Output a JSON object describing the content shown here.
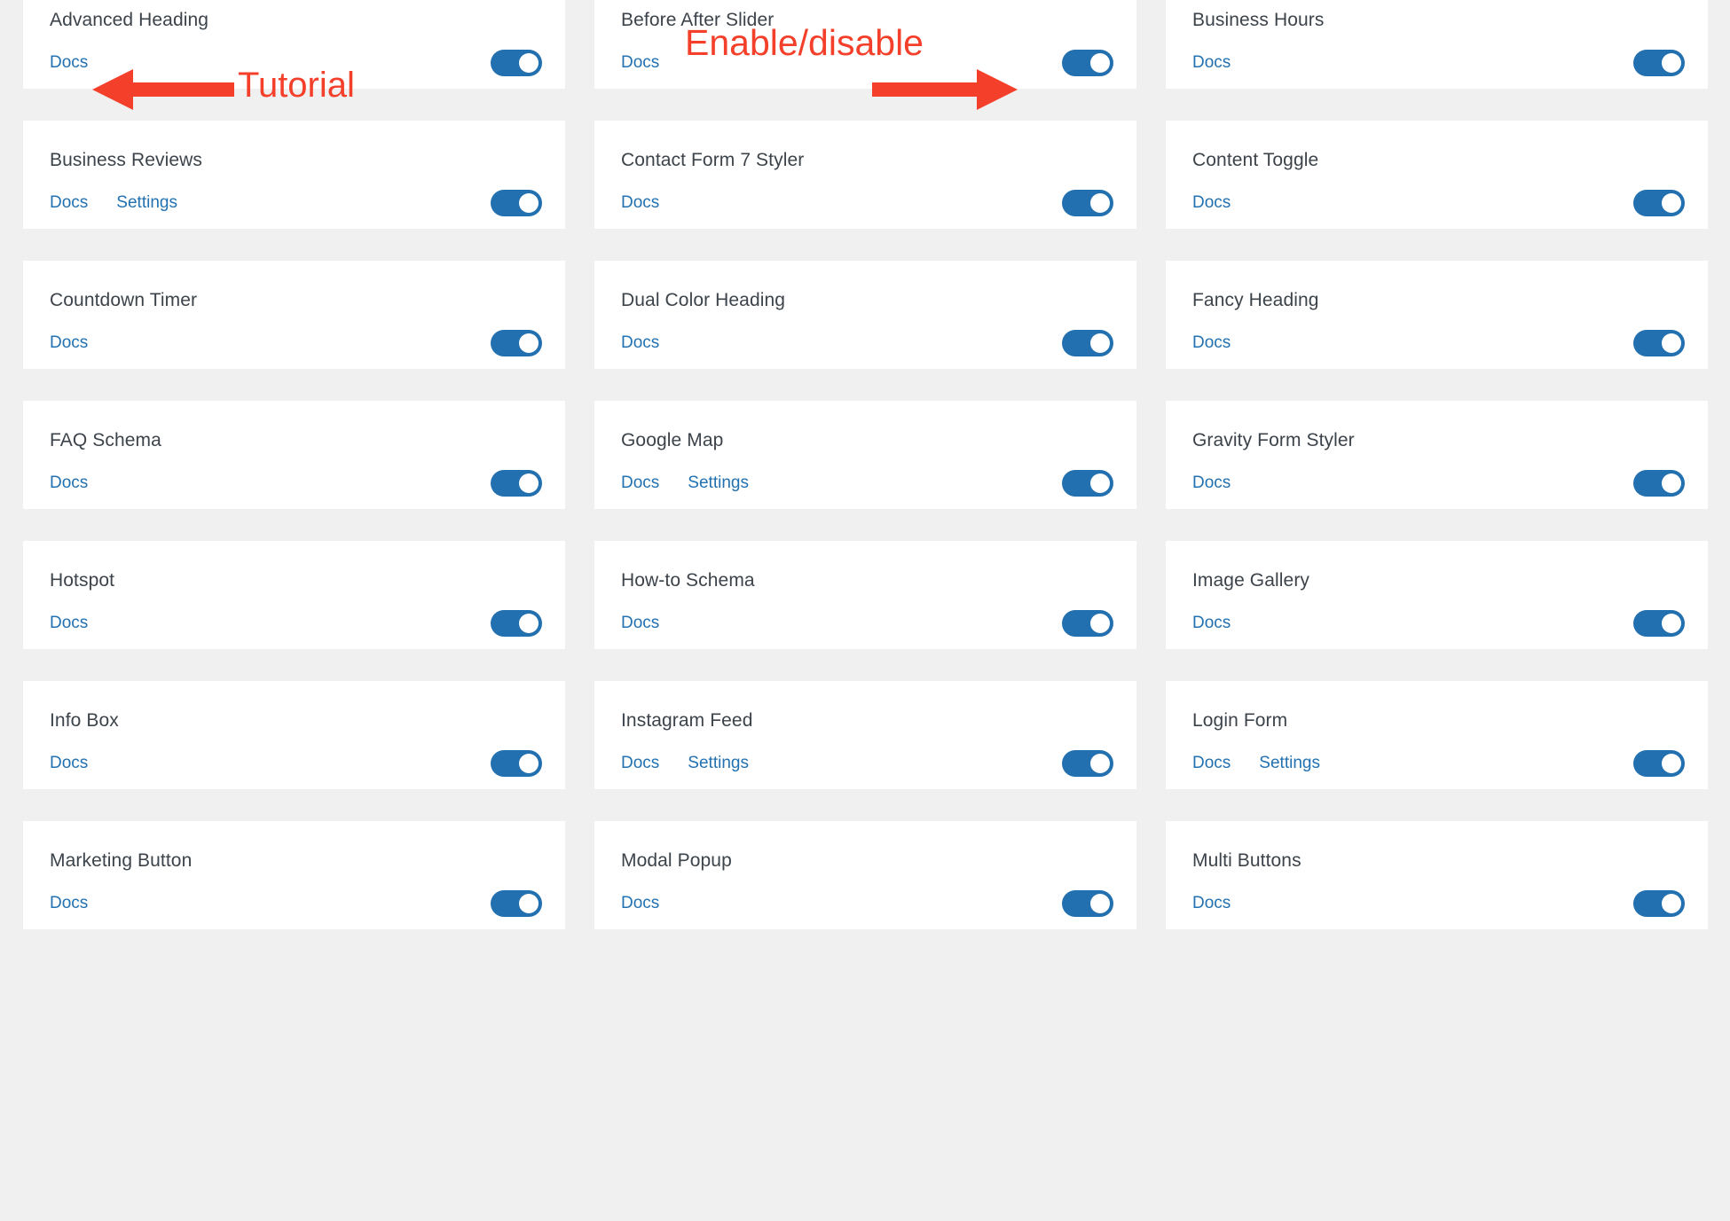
{
  "theme": {
    "page_background": "#f0f0f1",
    "card_background": "#ffffff",
    "title_color": "#3c434a",
    "link_color": "#2271b1",
    "toggle_on_color": "#2270b0",
    "annotation_color": "#f4402a"
  },
  "labels": {
    "docs": "Docs",
    "settings": "Settings"
  },
  "annotations": {
    "tutorial": {
      "text": "Tutorial",
      "arrow": "arrow-left-icon",
      "points_to": "Docs link of Advanced Heading"
    },
    "enable_disable": {
      "text": "Enable/disable",
      "arrow": "arrow-right-icon",
      "points_to": "toggle of Before After Slider"
    }
  },
  "modules": [
    {
      "name": "Advanced Heading",
      "docs": "Docs",
      "settings": null,
      "enabled": true
    },
    {
      "name": "Before After Slider",
      "docs": "Docs",
      "settings": null,
      "enabled": true
    },
    {
      "name": "Business Hours",
      "docs": "Docs",
      "settings": null,
      "enabled": true
    },
    {
      "name": "Business Reviews",
      "docs": "Docs",
      "settings": "Settings",
      "enabled": true
    },
    {
      "name": "Contact Form 7 Styler",
      "docs": "Docs",
      "settings": null,
      "enabled": true
    },
    {
      "name": "Content Toggle",
      "docs": "Docs",
      "settings": null,
      "enabled": true
    },
    {
      "name": "Countdown Timer",
      "docs": "Docs",
      "settings": null,
      "enabled": true
    },
    {
      "name": "Dual Color Heading",
      "docs": "Docs",
      "settings": null,
      "enabled": true
    },
    {
      "name": "Fancy Heading",
      "docs": "Docs",
      "settings": null,
      "enabled": true
    },
    {
      "name": "FAQ Schema",
      "docs": "Docs",
      "settings": null,
      "enabled": true
    },
    {
      "name": "Google Map",
      "docs": "Docs",
      "settings": "Settings",
      "enabled": true
    },
    {
      "name": "Gravity Form Styler",
      "docs": "Docs",
      "settings": null,
      "enabled": true
    },
    {
      "name": "Hotspot",
      "docs": "Docs",
      "settings": null,
      "enabled": true
    },
    {
      "name": "How-to Schema",
      "docs": "Docs",
      "settings": null,
      "enabled": true
    },
    {
      "name": "Image Gallery",
      "docs": "Docs",
      "settings": null,
      "enabled": true
    },
    {
      "name": "Info Box",
      "docs": "Docs",
      "settings": null,
      "enabled": true
    },
    {
      "name": "Instagram Feed",
      "docs": "Docs",
      "settings": "Settings",
      "enabled": true
    },
    {
      "name": "Login Form",
      "docs": "Docs",
      "settings": "Settings",
      "enabled": true
    },
    {
      "name": "Marketing Button",
      "docs": "Docs",
      "settings": null,
      "enabled": true
    },
    {
      "name": "Modal Popup",
      "docs": "Docs",
      "settings": null,
      "enabled": true
    },
    {
      "name": "Multi Buttons",
      "docs": "Docs",
      "settings": null,
      "enabled": true
    }
  ]
}
